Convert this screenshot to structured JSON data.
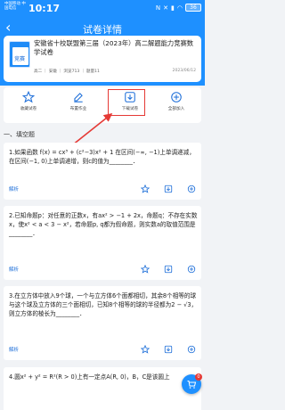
{
  "status": {
    "carrier": "中国移动 中国电信",
    "time": "10:17",
    "battery": "36"
  },
  "nav": {
    "title": "试卷详情"
  },
  "paper": {
    "thumb_text": "竞赛",
    "title": "安徽省十校联盟第三届（2023年）高二解题能力竞赛数学试卷",
    "meta": "高二 ｜ 安徽 ｜ 浏览713 ｜ 题量11",
    "date": "2023/06/12"
  },
  "actions": [
    {
      "label": "收藏试卷",
      "icon": "star-icon"
    },
    {
      "label": "布置作业",
      "icon": "assign-icon"
    },
    {
      "label": "下载试卷",
      "icon": "download-icon"
    },
    {
      "label": "全部加入",
      "icon": "add-all-icon"
    }
  ],
  "section": {
    "title": "一、填空题"
  },
  "questions": [
    {
      "text": "1.如果函数 f(x) = cx³ + (c²−3)x² + 1 在区间(−∞, −1)上单调递减，在区间(−1, 0)上单调递增，则c的值为________．",
      "parse": "解析"
    },
    {
      "text": "2.已知命题p：对任意的正数x，有ax² > −1 + 2x，命题q：不存在实数x，使x² < a < 3 − x²，若命题p, q都为假命题，则实数a的取值范围是________．",
      "parse": "解析"
    },
    {
      "text": "3.在立方体中放入9个球，一个与立方体6个面都相切，其余8个相等的球与这个球及立方体的三个面相切，已知8个相等的球的半径都为2 − √3，则立方体的棱长为________．",
      "parse": "解析"
    },
    {
      "text": "4.圆x² + y² = R²(R > 0)上有一定点A(R, 0)，B，C是该圆上",
      "parse": ""
    }
  ],
  "fab": {
    "badge": "0"
  },
  "colors": {
    "primary": "#1e90ff",
    "highlight": "#e53935",
    "link": "#1e6fd9",
    "background": "#f1f3f6"
  }
}
